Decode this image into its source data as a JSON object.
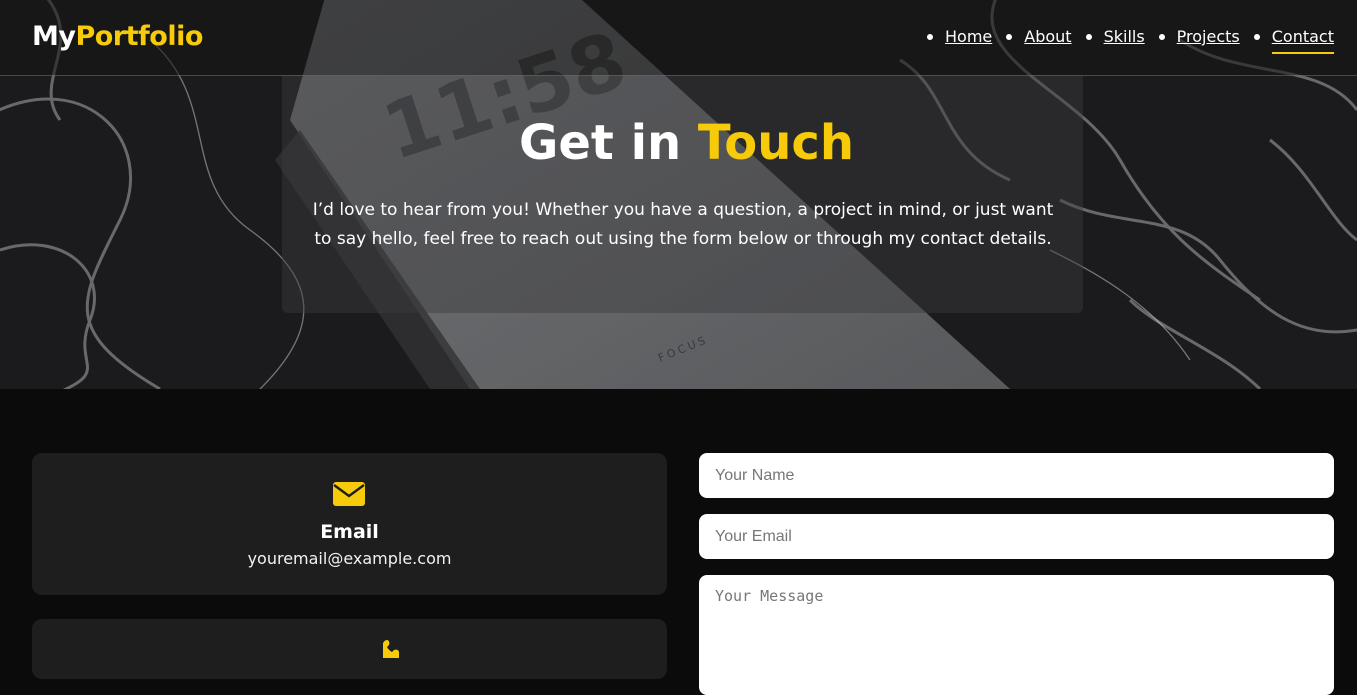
{
  "brand": {
    "part1": "My",
    "part2": "Portfolio"
  },
  "nav": {
    "items": [
      {
        "label": "Home"
      },
      {
        "label": "About"
      },
      {
        "label": "Skills"
      },
      {
        "label": "Projects"
      },
      {
        "label": "Contact",
        "active": true
      }
    ]
  },
  "hero": {
    "title_part1": "Get in",
    "title_part2": "Touch",
    "text": "I’d love to hear from you! Whether you have a question, a project in mind, or just want to say hello, feel free to reach out using the form below or through my contact details.",
    "background_phone_time": "11:58",
    "background_phone_label": "FOCUS"
  },
  "contact_info": {
    "email": {
      "title": "Email",
      "value": "youremail@example.com",
      "icon": "envelope-icon"
    },
    "phone": {
      "icon": "phone-icon"
    }
  },
  "form": {
    "name_placeholder": "Your Name",
    "email_placeholder": "Your Email",
    "message_placeholder": "Your Message"
  },
  "colors": {
    "accent": "#f7ca0a",
    "page_background": "#0b0b0b",
    "card_background": "#1e1e1e"
  }
}
